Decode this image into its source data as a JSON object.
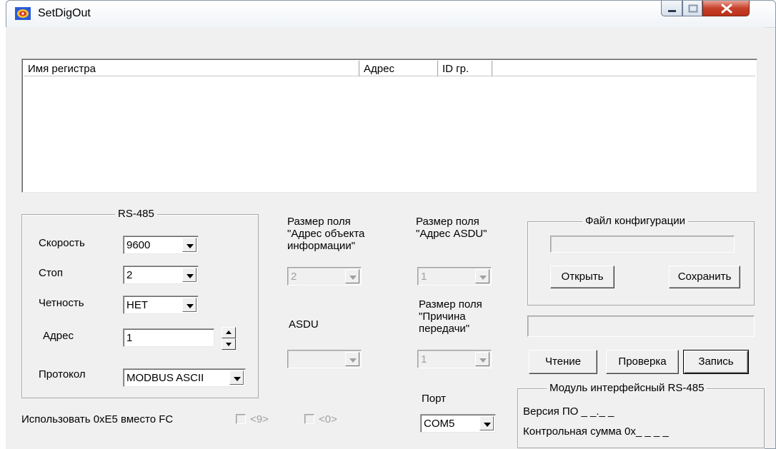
{
  "window": {
    "title": "SetDigOut"
  },
  "list": {
    "columns": [
      "Имя регистра",
      "Адрес",
      "ID гр."
    ]
  },
  "rs485": {
    "title": "RS-485",
    "speed_label": "Скорость",
    "speed_value": "9600",
    "stop_label": "Стоп",
    "stop_value": "2",
    "parity_label": "Четность",
    "parity_value": "НЕТ",
    "address_label": "Адрес",
    "address_value": "1",
    "protocol_label": "Протокол",
    "protocol_value": "MODBUS ASCII"
  },
  "fields": {
    "ioa_size_label": "Размер поля\n\"Адрес объекта\nинформации\"",
    "ioa_size_value": "2",
    "asdu_size_label": "Размер поля\n\"Адрес ASDU\"",
    "asdu_size_value": "1",
    "asdu_label": "ASDU",
    "asdu_value": "",
    "cause_size_label": "Размер поля\n\"Причина\nпередачи\"",
    "cause_size_value": "1",
    "port_label": "Порт",
    "port_value": "COM5"
  },
  "config": {
    "title": "Файл конфигурации",
    "path_value": "",
    "open_label": "Открыть",
    "save_label": "Сохранить"
  },
  "status_value": "",
  "actions": {
    "read_label": "Чтение",
    "check_label": "Проверка",
    "write_label": "Запись"
  },
  "module": {
    "title": "Модуль интерфейсный RS-485",
    "version_text": "Версия ПО _ _._ _",
    "checksum_text": "Контрольная сумма 0x_ _ _ _"
  },
  "options": {
    "use_e5_label": "Использовать 0xE5 вместо FC",
    "opt9_label": "<9>",
    "opt0_label": "<0>"
  },
  "colors": {
    "window_bg": "#f0f0f0",
    "close_button": "#c8412b",
    "disabled_text": "#a0a0a0"
  }
}
